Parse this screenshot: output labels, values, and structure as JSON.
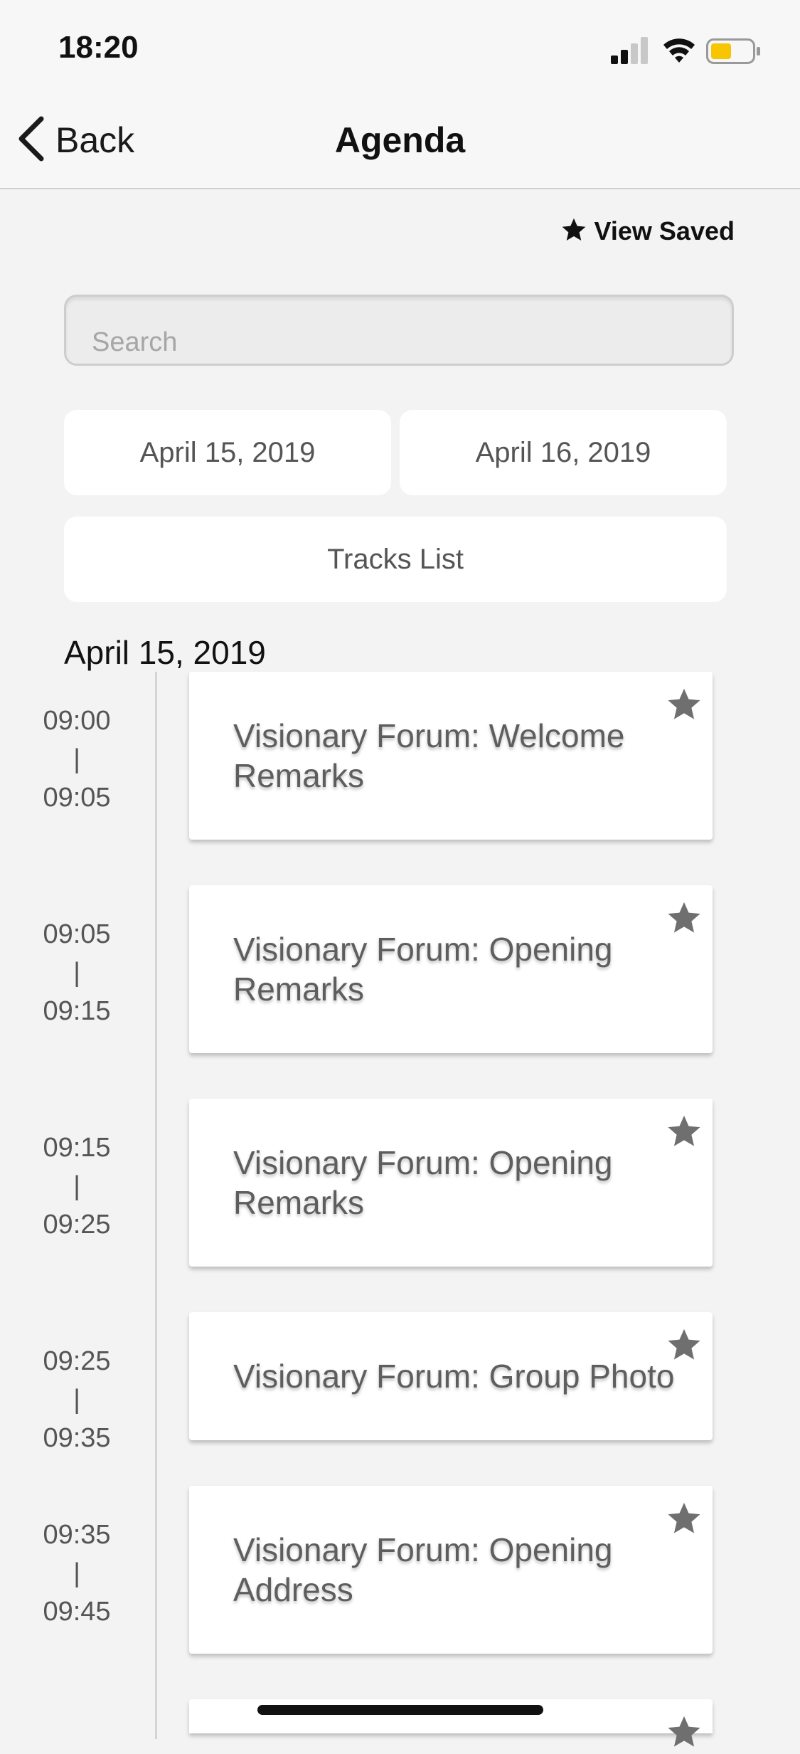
{
  "status_bar": {
    "time": "18:20",
    "icons": [
      "signal-icon",
      "wifi-icon",
      "battery-icon"
    ],
    "battery_color": "#f7c600"
  },
  "nav": {
    "back_label": "Back",
    "title": "Agenda"
  },
  "view_saved_label": "View Saved",
  "search": {
    "placeholder": "Search",
    "value": ""
  },
  "date_tabs": [
    "April 15, 2019",
    "April 16, 2019"
  ],
  "tracks_label": "Tracks List",
  "day_heading": "April 15, 2019",
  "sessions": [
    {
      "start": "09:00",
      "sep": "|",
      "end": "09:05",
      "title": "Visionary Forum: Welcome Remarks"
    },
    {
      "start": "09:05",
      "sep": "|",
      "end": "09:15",
      "title": "Visionary Forum: Opening Remarks"
    },
    {
      "start": "09:15",
      "sep": "|",
      "end": "09:25",
      "title": "Visionary Forum: Opening Remarks"
    },
    {
      "start": "09:25",
      "sep": "|",
      "end": "09:35",
      "title": "Visionary Forum: Group Photo"
    },
    {
      "start": "09:35",
      "sep": "|",
      "end": "09:45",
      "title": "Visionary Forum: Opening Address"
    }
  ],
  "colors": {
    "background": "#f3f3f3",
    "card": "#ffffff",
    "star": "#6f6f6f",
    "timeline": "#d4d4d4"
  }
}
